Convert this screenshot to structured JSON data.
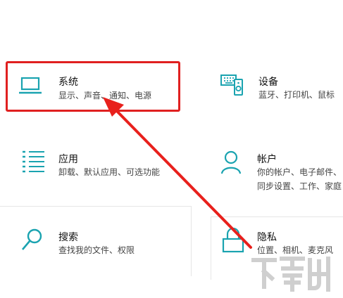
{
  "tiles": {
    "system": {
      "title": "系统",
      "desc": "显示、声音、通知、电源",
      "icon": "laptop-icon"
    },
    "devices": {
      "title": "设备",
      "desc": "蓝牙、打印机、鼠标",
      "icon": "keyboard-speaker-icon"
    },
    "apps": {
      "title": "应用",
      "desc": "卸载、默认应用、可选功能",
      "icon": "app-list-icon"
    },
    "accounts": {
      "title": "帐户",
      "desc": "你的帐户、电子邮件、同步设置、工作、家庭",
      "icon": "person-icon"
    },
    "search": {
      "title": "搜索",
      "desc": "查找我的文件、权限",
      "icon": "search-icon"
    },
    "privacy": {
      "title": "隐私",
      "desc": "位置、相机、麦克风",
      "icon": "lock-icon"
    }
  },
  "colors": {
    "accent": "#1aa3b0",
    "highlight": "#e02020",
    "arrow": "#e8201c"
  }
}
